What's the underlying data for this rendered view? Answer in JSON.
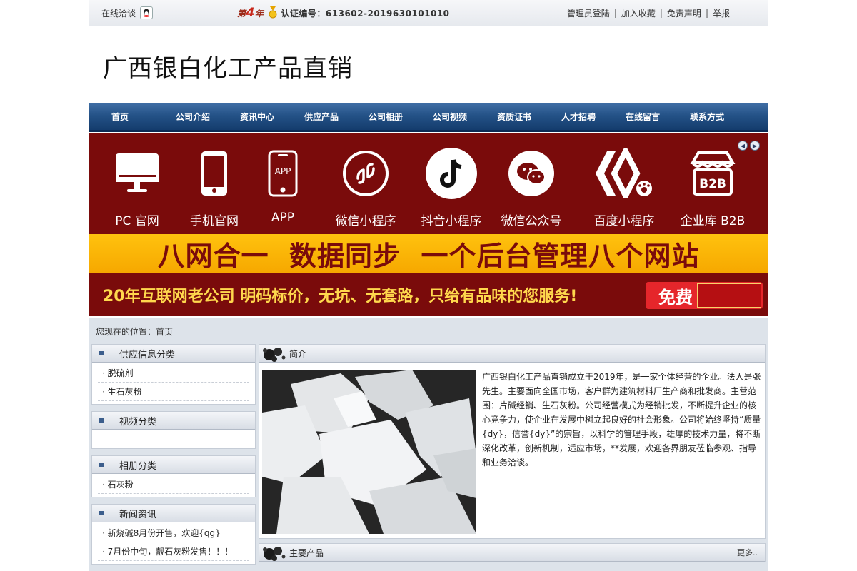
{
  "topbar": {
    "online_label": "在线洽谈",
    "year_prefix": "第",
    "year_num": "4",
    "year_suffix": "年",
    "cert_label": "认证编号：613602-2019630101010",
    "links": [
      "管理员登陆",
      "加入收藏",
      "免责声明",
      "举报"
    ]
  },
  "site": {
    "title": "广西银白化工产品直销"
  },
  "nav": {
    "items": [
      "首页",
      "公司介绍",
      "资讯中心",
      "供应产品",
      "公司相册",
      "公司视频",
      "资质证书",
      "人才招聘",
      "在线留言",
      "联系方式"
    ]
  },
  "banner": {
    "icons": [
      {
        "label": "PC 官网",
        "icon": "monitor-icon"
      },
      {
        "label": "手机官网",
        "icon": "phone-icon"
      },
      {
        "label": "APP",
        "icon": "app-icon"
      },
      {
        "label": "微信小程序",
        "icon": "miniprogram-icon"
      },
      {
        "label": "抖音小程序",
        "icon": "douyin-icon"
      },
      {
        "label": "微信公众号",
        "icon": "wechat-icon"
      },
      {
        "label": "百度小程序",
        "icon": "baidu-icon"
      },
      {
        "label": "企业库 B2B",
        "icon": "b2b-store-icon"
      }
    ],
    "app_text": "APP",
    "b2b_text": "B2B",
    "headline": "八网合一  数据同步  一个后台管理八个网站",
    "slogan": "20年互联网老公司  明码标价，无坑、无套路，只给有品味的您服务!",
    "free_label": "免费",
    "colors": {
      "bg": "#7a0b0b",
      "band": "#ffc20e",
      "slogan": "#ffd84d"
    }
  },
  "breadcrumb": "您现在的位置：首页",
  "sidebar": {
    "boxes": [
      {
        "title": "供应信息分类",
        "items": [
          "脱硫剂",
          "生石灰粉"
        ]
      },
      {
        "title": "视频分类",
        "items": []
      },
      {
        "title": "相册分类",
        "items": [
          "石灰粉"
        ]
      },
      {
        "title": "新闻资讯",
        "items": [
          "新烧碱8月份开售，欢迎{qg}",
          "7月份中旬，靓石灰粉发售！！！"
        ]
      }
    ]
  },
  "intro": {
    "title": "简介",
    "text": "广西银白化工产品直销成立于2019年，是一家个体经营的企业。法人是张先生。主要面向全国市场，客户群为建筑材料厂生产商和批发商。主营范围：片碱经销、生石灰粉。公司经营模式为经销批发，不断提升企业的核心竞争力，使企业在发展中树立起良好的社会形象。公司将始终坚持“质量{dy}，信誉{dy}”的宗旨，以科学的管理手段，雄厚的技术力量，将不断深化改革，创新机制，适应市场，**发展，欢迎各界朋友莅临参观、指导和业务洽谈。"
  },
  "products": {
    "title": "主要产品",
    "more": "更多.."
  }
}
